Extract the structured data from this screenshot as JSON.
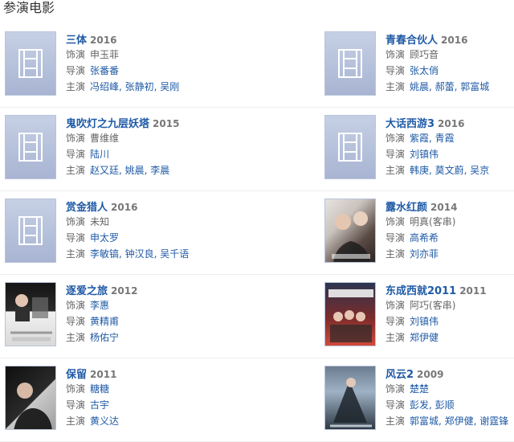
{
  "page": {
    "section_title": "参演电影"
  },
  "rows": [
    {
      "left": {
        "title": "三体",
        "year": "2016",
        "role_label": "饰演",
        "role": "申玉菲",
        "director_label": "导演",
        "director": "张番番",
        "cast_label": "主演",
        "cast": "冯绍峰, 张静初, 吴刚",
        "poster": "placeholder-icon"
      },
      "right": {
        "title": "青春合伙人",
        "year": "2016",
        "role_label": "饰演",
        "role": "顾巧音",
        "director_label": "导演",
        "director": "张太俏",
        "cast_label": "主演",
        "cast": "姚晨, 郝蕾, 郭富城",
        "poster": "placeholder-icon"
      }
    },
    {
      "left": {
        "title": "鬼吹灯之九层妖塔",
        "year": "2015",
        "role_label": "饰演",
        "role": "曹维维",
        "director_label": "导演",
        "director": "陆川",
        "cast_label": "主演",
        "cast": "赵又廷, 姚晨, 李晨",
        "poster": "placeholder-icon"
      },
      "right": {
        "title": "大话西游3",
        "year": "2016",
        "role_label": "饰演",
        "role": "紫霞, 青霞",
        "director_label": "导演",
        "director": "刘镇伟",
        "cast_label": "主演",
        "cast": "韩庚, 莫文蔚, 吴京",
        "poster": "placeholder-icon"
      }
    },
    {
      "left": {
        "title": "赏金猎人",
        "year": "2016",
        "role_label": "饰演",
        "role": "未知",
        "director_label": "导演",
        "director": "申太罗",
        "cast_label": "主演",
        "cast": "李敏镐, 钟汉良, 吴千语",
        "poster": "placeholder-icon"
      },
      "right": {
        "title": "露水红颜",
        "year": "2014",
        "role_label": "饰演",
        "role": "明真(客串)",
        "director_label": "导演",
        "director": "高希希",
        "cast_label": "主演",
        "cast": "刘亦菲",
        "poster": "photo"
      }
    },
    {
      "left": {
        "title": "逐爱之旅",
        "year": "2012",
        "role_label": "饰演",
        "role": "李惠",
        "director_label": "导演",
        "director": "黄精甫",
        "cast_label": "主演",
        "cast": "杨佑宁",
        "poster": "photo"
      },
      "right": {
        "title": "东成西就2011",
        "year": "2011",
        "role_label": "饰演",
        "role": "阿巧(客串)",
        "director_label": "导演",
        "director": "刘镇伟",
        "cast_label": "主演",
        "cast": "郑伊健",
        "poster": "photo"
      }
    },
    {
      "left": {
        "title": "保留",
        "year": "2011",
        "role_label": "饰演",
        "role": "糖糖",
        "director_label": "导演",
        "director": "古宇",
        "cast_label": "主演",
        "cast": "黄义达",
        "poster": "photo"
      },
      "right": {
        "title": "风云2",
        "year": "2009",
        "role_label": "饰演",
        "role": "楚楚",
        "director_label": "导演",
        "director": "彭发, 彭顺",
        "cast_label": "主演",
        "cast": "郭富城, 郑伊健, 谢霆锋",
        "poster": "photo"
      }
    }
  ],
  "colors": {
    "link": "#1f5aa6",
    "text": "#666666",
    "placeholder": "#b9c3da"
  }
}
